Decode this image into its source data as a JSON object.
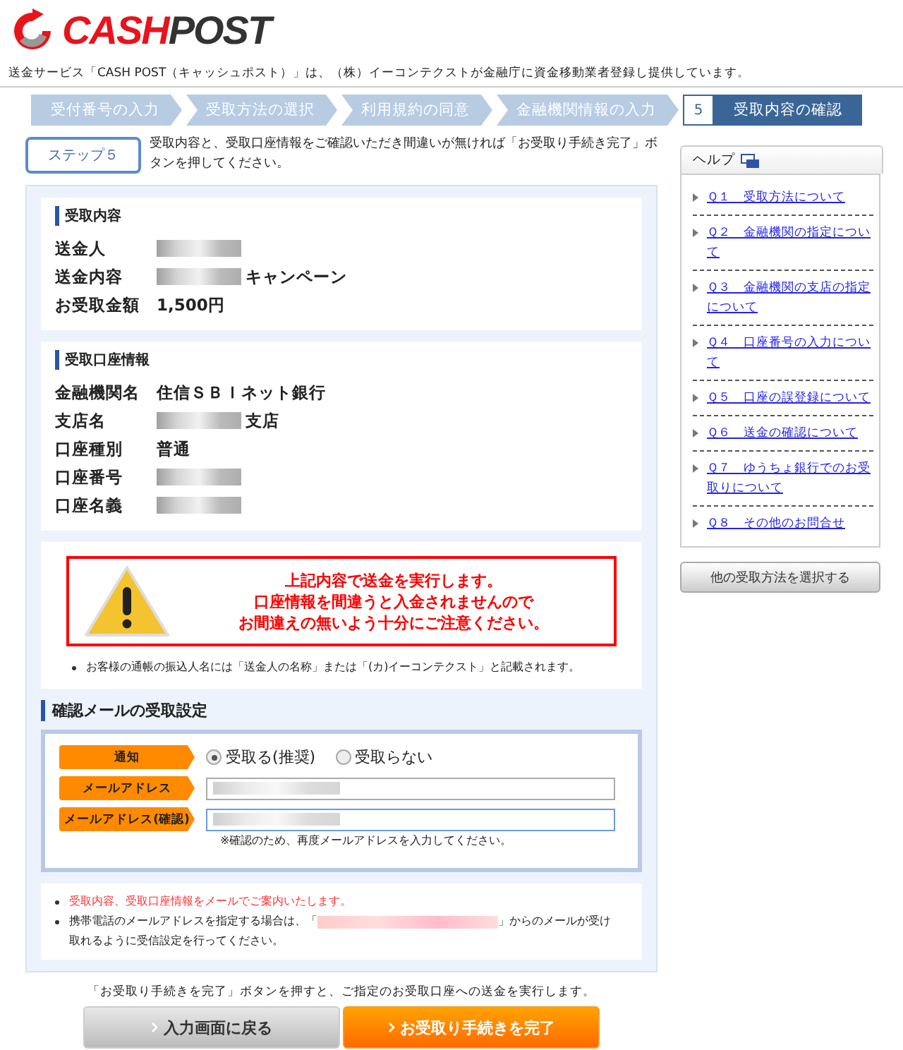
{
  "logo": {
    "part_1": "CASH",
    "part_2": "POST"
  },
  "tagline": "送金サービス「CASH POST（キャッシュポスト）」は、（株）イーコンテクストが金融庁に資金移動業者登録し提供しています。",
  "steps": [
    {
      "label": "受付番号の入力",
      "selected": false
    },
    {
      "label": "受取方法の選択",
      "selected": false
    },
    {
      "label": "利用規約の同意",
      "selected": false
    },
    {
      "label": "金融機関情報の入力",
      "selected": false
    },
    {
      "number": "5",
      "label": "受取内容の確認",
      "selected": true
    }
  ],
  "step_badge": "ステップ５",
  "intro": "受取内容と、受取口座情報をご確認いただき間違いが無ければ「お受取り手続き完了」ボタンを押してください。",
  "sections": [
    {
      "title": "受取内容",
      "rows": [
        {
          "label": "送金人",
          "redacted": true
        },
        {
          "label": "送金内容",
          "redacted": true,
          "value": "キャンペーン"
        },
        {
          "label": "お受取金額",
          "redacted": false,
          "value": "1,500円"
        }
      ]
    },
    {
      "title": "受取口座情報",
      "rows": [
        {
          "label": "金融機関名",
          "redacted": false,
          "value": "住信ＳＢＩネット銀行"
        },
        {
          "label": "支店名",
          "redacted": true,
          "value": "支店"
        },
        {
          "label": "口座種別",
          "redacted": false,
          "value": "普通"
        },
        {
          "label": "口座番号",
          "redacted": true
        },
        {
          "label": "口座名義",
          "redacted": true
        }
      ]
    }
  ],
  "warning": [
    "上記内容で送金を実行します。",
    "口座情報を間違うと入金されませんので",
    "お間違えの無いよう十分にご注意ください。"
  ],
  "warning_note": "お客様の通帳の振込人名には「送金人の名称」または「(カ)イーコンテクスト」と記載されます。",
  "mail_settings": {
    "title": "確認メールの受取設定",
    "notify_label": "通知",
    "options": [
      {
        "label": "受取る(推奨)",
        "selected": true
      },
      {
        "label": "受取らない",
        "selected": false
      }
    ],
    "email_label": "メールアドレス",
    "confirm_label": "メールアドレス(確認)",
    "confirm_hint": "※確認のため、再度メールアドレスを入力してください。"
  },
  "notes": [
    {
      "kind": "alert",
      "text": "受取内容、受取口座情報をメールでご案内いたします。"
    },
    {
      "kind": "plain",
      "text_before": "携帯電話のメールアドレスを指定する場合は、「",
      "text_after": "」からのメールが受け",
      "text_continued": "取れるように受信設定を行ってください。"
    }
  ],
  "footer_note": "「お受取り手続きを完了」ボタンを押すと、ご指定のお受取口座への送金を実行します。",
  "buttons": [
    {
      "kind": "back",
      "label": "入力画面に戻る"
    },
    {
      "kind": "primary",
      "label": "お受取り手続きを完了"
    }
  ],
  "help": {
    "title": "ヘルプ",
    "links": [
      "Ｑ１　受取方法について",
      "Ｑ２　金融機関の指定について",
      "Ｑ３　金融機関の支店の指定について",
      "Ｑ４　口座番号の入力について",
      "Ｑ５　口座の誤登録について",
      "Ｑ６　送金の確認について",
      "Ｑ７　ゆうちょ銀行でのお受取りについて",
      "Ｑ８　その他のお問合せ"
    ],
    "other_button": "他の受取方法を選択する"
  }
}
